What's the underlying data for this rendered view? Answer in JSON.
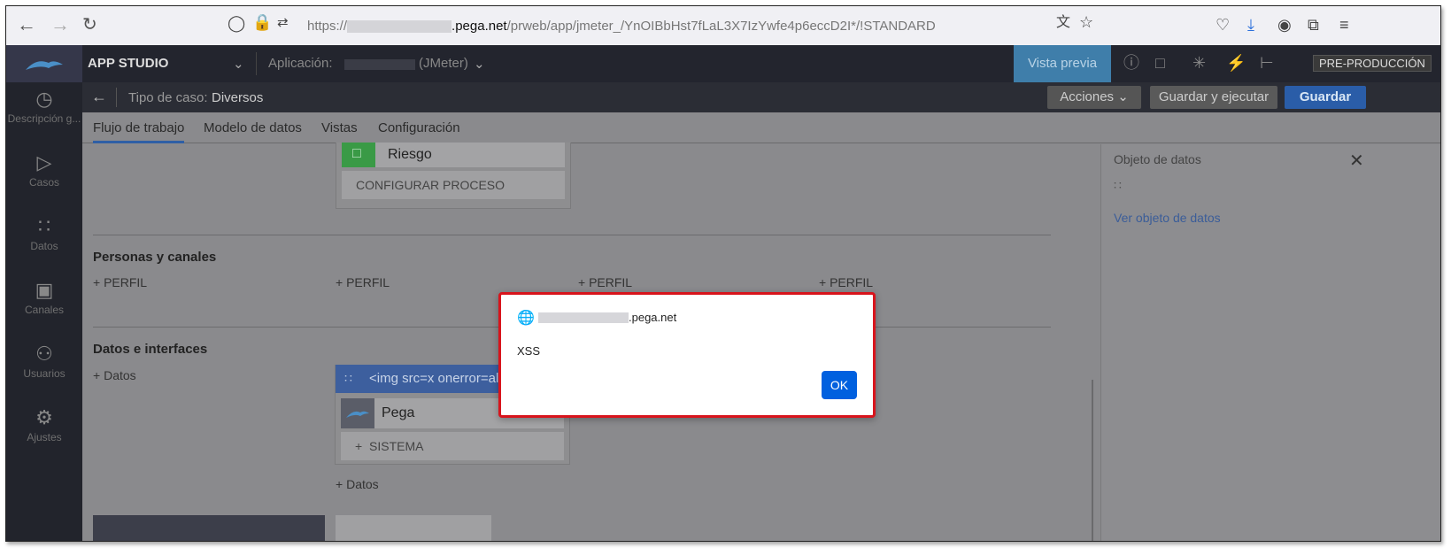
{
  "browser": {
    "url_prefix": "https://",
    "url_host": ".pega.net",
    "url_path": "/prweb/app/jmeter_/YnOIBbHst7fLaL3X7IzYwfe4p6eccD2I*/!STANDARD"
  },
  "header": {
    "app_label": "APP STUDIO",
    "app_dropdown_icon": "chevron-down-icon",
    "application_label": "Aplicación:",
    "application_suffix": "(JMeter)",
    "preview_button": "Vista previa",
    "env_badge": "PRE-PRODUCCIÓN"
  },
  "subheader": {
    "case_type_label": "Tipo de caso:",
    "case_type_value": "Diversos",
    "actions_button": "Acciones",
    "save_run_button": "Guardar y ejecutar",
    "save_button": "Guardar"
  },
  "sidebar": {
    "items": [
      {
        "label": "Descripción g..."
      },
      {
        "label": "Casos"
      },
      {
        "label": "Datos"
      },
      {
        "label": "Canales"
      },
      {
        "label": "Usuarios"
      },
      {
        "label": "Ajustes"
      }
    ]
  },
  "tabs": [
    "Flujo de trabajo",
    "Modelo de datos",
    "Vistas",
    "Configuración"
  ],
  "workflow": {
    "risk_card_title": "Riesgo",
    "configure_process": "CONFIGURAR PROCESO"
  },
  "personas": {
    "title": "Personas y canales",
    "profiles": [
      "PERFIL",
      "PERFIL",
      "PERFIL",
      "PERFIL"
    ]
  },
  "data_interfaces": {
    "title": "Datos e interfaces",
    "add_data": "Datos",
    "object_title": "<img src=x onerror=ale",
    "system_name": "Pega",
    "add_system": "SISTEMA",
    "add_data_2": "Datos"
  },
  "right_panel": {
    "title": "Objeto de datos",
    "link": "Ver objeto de datos"
  },
  "dialog": {
    "origin_host": ".pega.net",
    "message": "XSS",
    "ok_label": "OK"
  },
  "colors": {
    "accent_blue": "#0060df",
    "dialog_border": "#d8141c",
    "header_bg": "#23252e"
  }
}
